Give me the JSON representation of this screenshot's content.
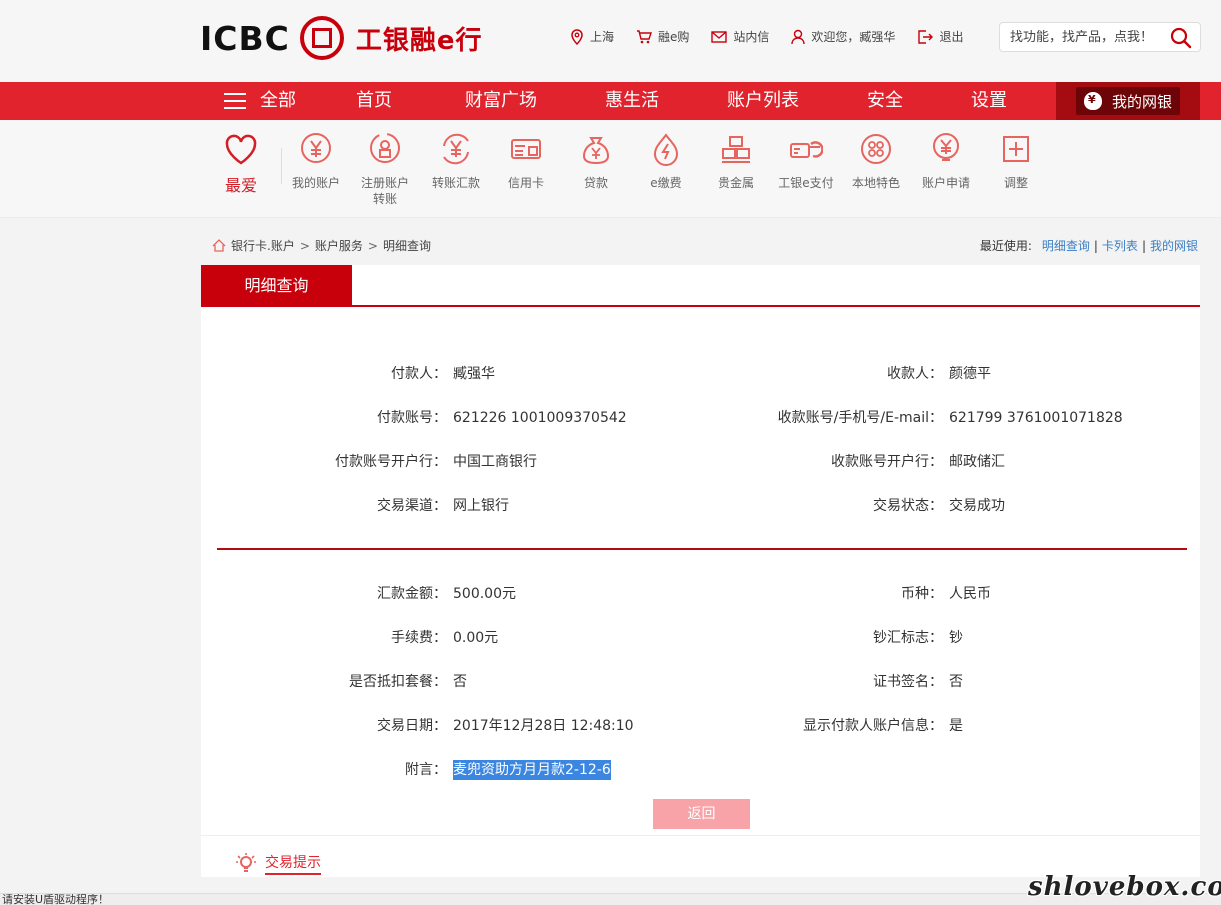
{
  "header": {
    "logo_text": "ICBC",
    "logo_cn": "工银融e行",
    "links": [
      {
        "icon": "location-icon",
        "label": "上海"
      },
      {
        "icon": "cart-icon",
        "label": "融e购"
      },
      {
        "icon": "mail-icon",
        "label": "站内信"
      },
      {
        "icon": "user-icon",
        "label": "欢迎您，臧强华"
      },
      {
        "icon": "logout-icon",
        "label": "退出"
      }
    ],
    "search_placeholder": "找功能，找产品，点我！"
  },
  "nav": {
    "all": "全部",
    "items": [
      "首页",
      "财富广场",
      "惠生活",
      "账户列表",
      "安全",
      "设置"
    ],
    "mybank": "我的网银"
  },
  "quick": {
    "fav": "最爱",
    "items": [
      {
        "icon": "yen-circle-icon",
        "label": "我的账户"
      },
      {
        "icon": "register-account-icon",
        "label": "注册账户转账"
      },
      {
        "icon": "transfer-yen-icon",
        "label": "转账汇款"
      },
      {
        "icon": "credit-card-icon",
        "label": "信用卡"
      },
      {
        "icon": "money-bag-icon",
        "label": "贷款"
      },
      {
        "icon": "flame-pay-icon",
        "label": "e缴费"
      },
      {
        "icon": "gold-bars-icon",
        "label": "贵金属"
      },
      {
        "icon": "epay-card-icon",
        "label": "工银e支付"
      },
      {
        "icon": "local-feature-icon",
        "label": "本地特色"
      },
      {
        "icon": "account-apply-icon",
        "label": "账户申请"
      },
      {
        "icon": "plus-square-icon",
        "label": "调整"
      }
    ]
  },
  "breadcrumb": {
    "items": [
      "银行卡.账户",
      "账户服务",
      "明细查询"
    ],
    "sep": ">",
    "recent_label": "最近使用:",
    "recent_links": [
      "明细查询",
      "卡列表",
      "我的网银"
    ]
  },
  "panel": {
    "tab": "明细查询",
    "left_fields": [
      {
        "label": "付款人：",
        "value": "臧强华"
      },
      {
        "label": "付款账号：",
        "value": "621226 1001009370542"
      },
      {
        "label": "付款账号开户行：",
        "value": "中国工商银行"
      },
      {
        "label": "交易渠道：",
        "value": "网上银行"
      }
    ],
    "right_fields": [
      {
        "label": "收款人：",
        "value": "颜德平"
      },
      {
        "label": "收款账号/手机号/E-mail：",
        "value": "621799 3761001071828"
      },
      {
        "label": "收款账号开户行：",
        "value": "邮政储汇"
      },
      {
        "label": "交易状态：",
        "value": "交易成功"
      }
    ],
    "left_fields2": [
      {
        "label": "汇款金额：",
        "value": "500.00元"
      },
      {
        "label": "手续费：",
        "value": "0.00元"
      },
      {
        "label": "是否抵扣套餐：",
        "value": "否"
      },
      {
        "label": "交易日期：",
        "value": "2017年12月28日 12:48:10"
      },
      {
        "label": "附言：",
        "value": "麦兜资助方月月款2-12-6"
      }
    ],
    "right_fields2": [
      {
        "label": "币种：",
        "value": "人民币"
      },
      {
        "label": "钞汇标志：",
        "value": "钞"
      },
      {
        "label": "证书签名：",
        "value": "否"
      },
      {
        "label": "显示付款人账户信息：",
        "value": "是"
      }
    ],
    "back_button": "返回"
  },
  "tips": {
    "title": "交易提示"
  },
  "statusbar": {
    "text": "请安装U盾驱动程序！"
  },
  "watermark": "shlovebox.com",
  "colors": {
    "brand_red": "#e1232d",
    "dark_red": "#c7000b",
    "link_blue": "#3b7fc4",
    "highlight_blue": "#3b86e0"
  }
}
